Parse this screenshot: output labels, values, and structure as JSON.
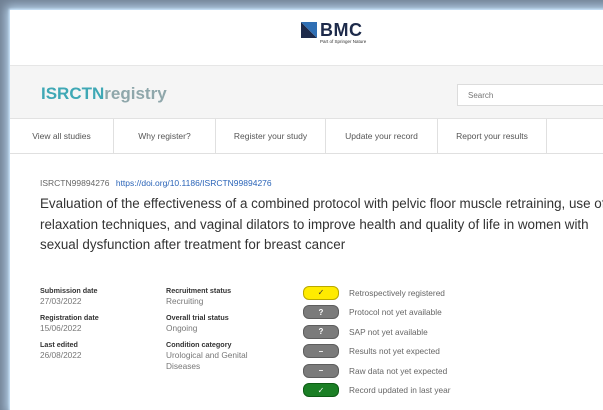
{
  "header": {
    "brand": "BMC",
    "brand_sub": "Part of Springer Nature"
  },
  "registry": {
    "logo_part1": "ISRCTN",
    "logo_part2": "registry",
    "search_placeholder": "Search"
  },
  "nav": {
    "items": [
      {
        "label": "View all studies"
      },
      {
        "label": "Why register?"
      },
      {
        "label": "Register your study"
      },
      {
        "label": "Update your record"
      },
      {
        "label": "Report your results"
      }
    ]
  },
  "record": {
    "id": "ISRCTN99894276",
    "doi": "https://doi.org/10.1186/ISRCTN99894276",
    "title": "Evaluation of the effectiveness of a combined protocol with pelvic floor muscle retraining, use of relaxation techniques, and vaginal dilators to improve health and quality of life in women with sexual dysfunction after treatment for breast cancer"
  },
  "details": {
    "submission_date_label": "Submission date",
    "submission_date": "27/03/2022",
    "registration_date_label": "Registration date",
    "registration_date": "15/06/2022",
    "last_edited_label": "Last edited",
    "last_edited": "26/08/2022",
    "recruitment_status_label": "Recruitment status",
    "recruitment_status": "Recruiting",
    "overall_status_label": "Overall trial status",
    "overall_status": "Ongoing",
    "condition_label": "Condition category",
    "condition": "Urological and Genital Diseases"
  },
  "badges": [
    {
      "symbol": "✓",
      "color": "yellow",
      "text": "Retrospectively registered"
    },
    {
      "symbol": "?",
      "color": "gray",
      "text": "Protocol not yet available"
    },
    {
      "symbol": "?",
      "color": "gray",
      "text": "SAP not yet available"
    },
    {
      "symbol": "–",
      "color": "gray",
      "text": "Results not yet expected"
    },
    {
      "symbol": "–",
      "color": "gray",
      "text": "Raw data not yet expected"
    },
    {
      "symbol": "✓",
      "color": "green",
      "text": "Record updated in last year"
    }
  ],
  "colors": {
    "accent": "#3fa8b5",
    "link": "#2a64b8",
    "brand": "#1d2a4a"
  }
}
